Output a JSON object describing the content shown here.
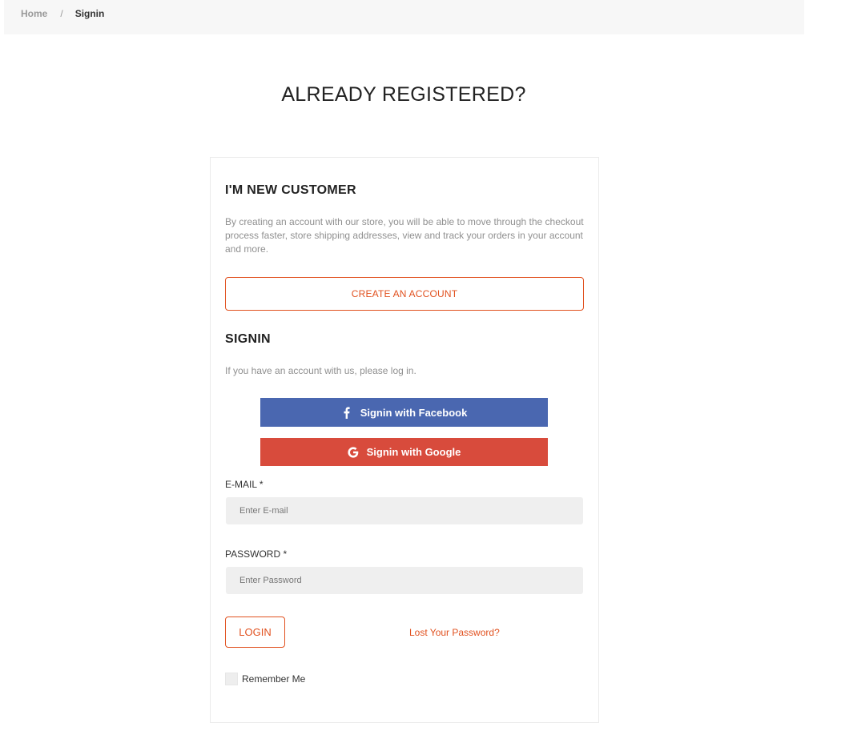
{
  "breadcrumb": {
    "home": "Home",
    "separator": "/",
    "current": "Signin"
  },
  "page_title": "ALREADY REGISTERED?",
  "new_customer": {
    "heading": "I'M NEW CUSTOMER",
    "description": "By creating an account with our store, you will be able to move through the checkout process faster, store shipping addresses, view and track your orders in your account and more.",
    "create_account_label": "CREATE AN ACCOUNT"
  },
  "signin": {
    "heading": "SIGNIN",
    "description": "If you have an account with us, please log in.",
    "facebook_label": "Signin with Facebook",
    "facebook_icon": "facebook-icon",
    "google_label": "Signin with Google",
    "google_icon": "google-icon",
    "email_label": "E-MAIL *",
    "email_placeholder": "Enter E-mail",
    "email_value": "",
    "password_label": "PASSWORD *",
    "password_placeholder": "Enter Password",
    "password_value": "",
    "login_label": "LOGIN",
    "lost_password_label": "Lost Your Password?",
    "remember_label": "Remember Me",
    "remember_checked": false
  },
  "colors": {
    "accent": "#e1511f",
    "facebook": "#4a67b0",
    "google": "#d84b3c",
    "input_bg": "#efefef",
    "breadcrumb_bg": "#f7f7f7"
  }
}
